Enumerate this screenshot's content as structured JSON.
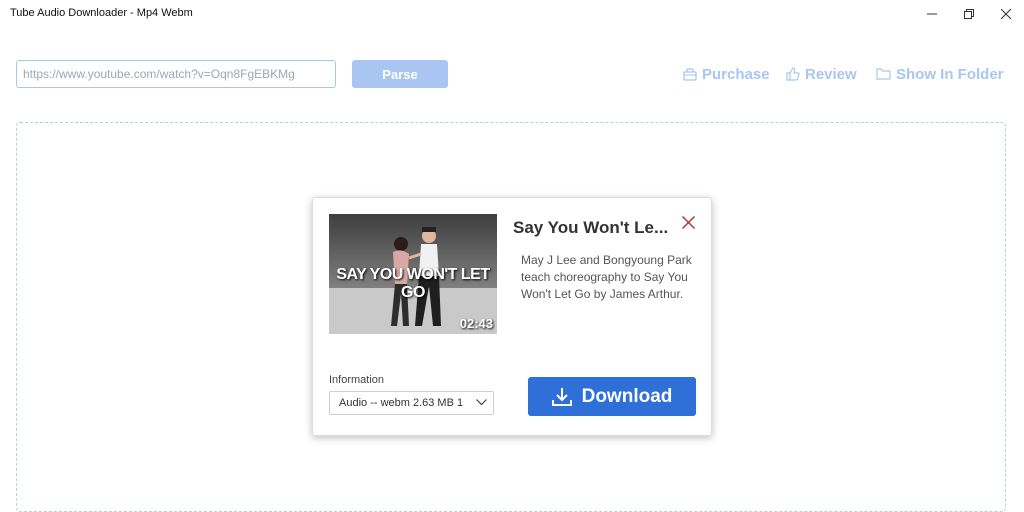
{
  "window": {
    "title": "Tube Audio Downloader - Mp4 Webm"
  },
  "toolbar": {
    "url_value": "https://www.youtube.com/watch?v=Oqn8FgEBKMg",
    "parse_label": "Parse",
    "purchase_label": "Purchase",
    "review_label": "Review",
    "show_in_folder_label": "Show In Folder"
  },
  "video": {
    "title": "Say You Won't Le...",
    "description": "May J Lee and Bongyoung Park teach choreography to Say You Won't Let Go by James Arthur.",
    "thumbnail_text": "SAY YOU WON'T LET GO",
    "duration": "02:43"
  },
  "download": {
    "info_label": "Information",
    "format_selected": "Audio -- webm 2.63 MB 1",
    "button_label": "Download"
  },
  "colors": {
    "accent": "#2e6fd8",
    "light_accent": "#a9c6f2",
    "close": "#c62828"
  }
}
